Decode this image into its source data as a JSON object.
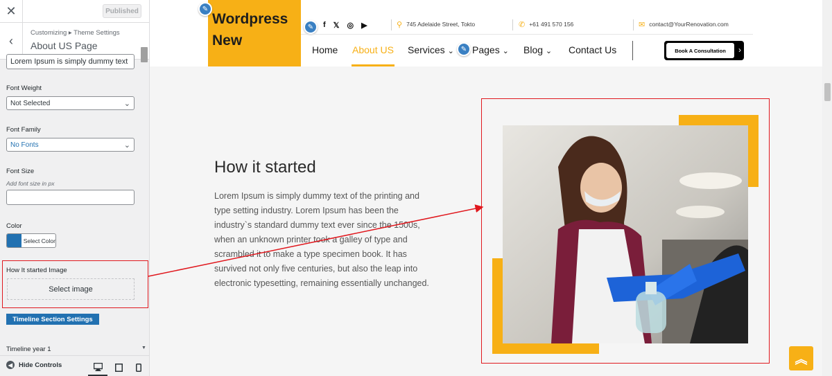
{
  "customizer": {
    "close_icon": "close-icon",
    "publish_label": "Published",
    "breadcrumb": "Customizing ▸ Theme Settings",
    "section_title": "About US Page",
    "text_value": "Lorem Ipsum is simply dummy text",
    "font_weight_label": "Font Weight",
    "font_weight_value": "Not Selected",
    "font_family_label": "Font Family",
    "font_family_value": "No Fonts",
    "font_size_label": "Font Size",
    "font_size_hint": "Add font size in px",
    "font_size_value": "",
    "color_label": "Color",
    "color_button": "Select Color",
    "color_swatch": "#2271b1",
    "image_label": "How It started Image",
    "select_image": "Select image",
    "timeline_button": "Timeline Section Settings",
    "timeline_year_label": "Timeline year 1",
    "hide_controls": "Hide Controls"
  },
  "site": {
    "logo": "Wordpress New",
    "address": "745 Adelaide Street, Tokto",
    "phone": "+61 491 570 156",
    "email": "contact@YourRenovation.com",
    "nav": {
      "home": "Home",
      "about": "About US",
      "services": "Services",
      "pages": "Pages",
      "blog": "Blog",
      "contact": "Contact Us"
    },
    "cta": "Book A Consultation",
    "brand_color": "#f7b016"
  },
  "about": {
    "title": "How it started",
    "body": "Lorem Ipsum is simply dummy text of the printing and type setting industry. Lorem Ipsum has been the industry`s standard dummy text ever since the 1500s, when an unknown printer took a galley of type and scrambled it to make a type specimen book. It has survived not only five centuries, but also the leap into electronic typesetting, remaining essentially unchanged."
  }
}
